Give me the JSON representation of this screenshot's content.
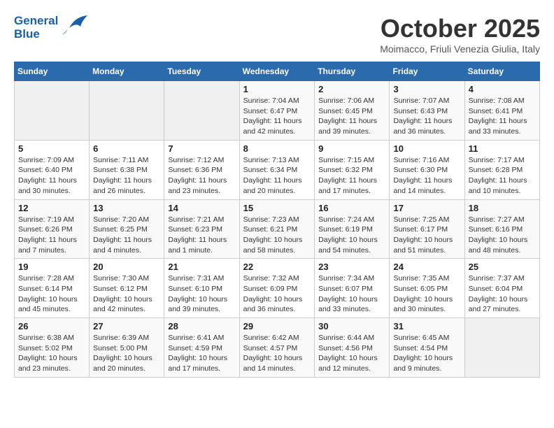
{
  "header": {
    "logo_line1": "General",
    "logo_line2": "Blue",
    "month_title": "October 2025",
    "location": "Moimacco, Friuli Venezia Giulia, Italy"
  },
  "weekdays": [
    "Sunday",
    "Monday",
    "Tuesday",
    "Wednesday",
    "Thursday",
    "Friday",
    "Saturday"
  ],
  "weeks": [
    [
      {
        "day": "",
        "info": ""
      },
      {
        "day": "",
        "info": ""
      },
      {
        "day": "",
        "info": ""
      },
      {
        "day": "1",
        "info": "Sunrise: 7:04 AM\nSunset: 6:47 PM\nDaylight: 11 hours and 42 minutes."
      },
      {
        "day": "2",
        "info": "Sunrise: 7:06 AM\nSunset: 6:45 PM\nDaylight: 11 hours and 39 minutes."
      },
      {
        "day": "3",
        "info": "Sunrise: 7:07 AM\nSunset: 6:43 PM\nDaylight: 11 hours and 36 minutes."
      },
      {
        "day": "4",
        "info": "Sunrise: 7:08 AM\nSunset: 6:41 PM\nDaylight: 11 hours and 33 minutes."
      }
    ],
    [
      {
        "day": "5",
        "info": "Sunrise: 7:09 AM\nSunset: 6:40 PM\nDaylight: 11 hours and 30 minutes."
      },
      {
        "day": "6",
        "info": "Sunrise: 7:11 AM\nSunset: 6:38 PM\nDaylight: 11 hours and 26 minutes."
      },
      {
        "day": "7",
        "info": "Sunrise: 7:12 AM\nSunset: 6:36 PM\nDaylight: 11 hours and 23 minutes."
      },
      {
        "day": "8",
        "info": "Sunrise: 7:13 AM\nSunset: 6:34 PM\nDaylight: 11 hours and 20 minutes."
      },
      {
        "day": "9",
        "info": "Sunrise: 7:15 AM\nSunset: 6:32 PM\nDaylight: 11 hours and 17 minutes."
      },
      {
        "day": "10",
        "info": "Sunrise: 7:16 AM\nSunset: 6:30 PM\nDaylight: 11 hours and 14 minutes."
      },
      {
        "day": "11",
        "info": "Sunrise: 7:17 AM\nSunset: 6:28 PM\nDaylight: 11 hours and 10 minutes."
      }
    ],
    [
      {
        "day": "12",
        "info": "Sunrise: 7:19 AM\nSunset: 6:26 PM\nDaylight: 11 hours and 7 minutes."
      },
      {
        "day": "13",
        "info": "Sunrise: 7:20 AM\nSunset: 6:25 PM\nDaylight: 11 hours and 4 minutes."
      },
      {
        "day": "14",
        "info": "Sunrise: 7:21 AM\nSunset: 6:23 PM\nDaylight: 11 hours and 1 minute."
      },
      {
        "day": "15",
        "info": "Sunrise: 7:23 AM\nSunset: 6:21 PM\nDaylight: 10 hours and 58 minutes."
      },
      {
        "day": "16",
        "info": "Sunrise: 7:24 AM\nSunset: 6:19 PM\nDaylight: 10 hours and 54 minutes."
      },
      {
        "day": "17",
        "info": "Sunrise: 7:25 AM\nSunset: 6:17 PM\nDaylight: 10 hours and 51 minutes."
      },
      {
        "day": "18",
        "info": "Sunrise: 7:27 AM\nSunset: 6:16 PM\nDaylight: 10 hours and 48 minutes."
      }
    ],
    [
      {
        "day": "19",
        "info": "Sunrise: 7:28 AM\nSunset: 6:14 PM\nDaylight: 10 hours and 45 minutes."
      },
      {
        "day": "20",
        "info": "Sunrise: 7:30 AM\nSunset: 6:12 PM\nDaylight: 10 hours and 42 minutes."
      },
      {
        "day": "21",
        "info": "Sunrise: 7:31 AM\nSunset: 6:10 PM\nDaylight: 10 hours and 39 minutes."
      },
      {
        "day": "22",
        "info": "Sunrise: 7:32 AM\nSunset: 6:09 PM\nDaylight: 10 hours and 36 minutes."
      },
      {
        "day": "23",
        "info": "Sunrise: 7:34 AM\nSunset: 6:07 PM\nDaylight: 10 hours and 33 minutes."
      },
      {
        "day": "24",
        "info": "Sunrise: 7:35 AM\nSunset: 6:05 PM\nDaylight: 10 hours and 30 minutes."
      },
      {
        "day": "25",
        "info": "Sunrise: 7:37 AM\nSunset: 6:04 PM\nDaylight: 10 hours and 27 minutes."
      }
    ],
    [
      {
        "day": "26",
        "info": "Sunrise: 6:38 AM\nSunset: 5:02 PM\nDaylight: 10 hours and 23 minutes."
      },
      {
        "day": "27",
        "info": "Sunrise: 6:39 AM\nSunset: 5:00 PM\nDaylight: 10 hours and 20 minutes."
      },
      {
        "day": "28",
        "info": "Sunrise: 6:41 AM\nSunset: 4:59 PM\nDaylight: 10 hours and 17 minutes."
      },
      {
        "day": "29",
        "info": "Sunrise: 6:42 AM\nSunset: 4:57 PM\nDaylight: 10 hours and 14 minutes."
      },
      {
        "day": "30",
        "info": "Sunrise: 6:44 AM\nSunset: 4:56 PM\nDaylight: 10 hours and 12 minutes."
      },
      {
        "day": "31",
        "info": "Sunrise: 6:45 AM\nSunset: 4:54 PM\nDaylight: 10 hours and 9 minutes."
      },
      {
        "day": "",
        "info": ""
      }
    ]
  ]
}
